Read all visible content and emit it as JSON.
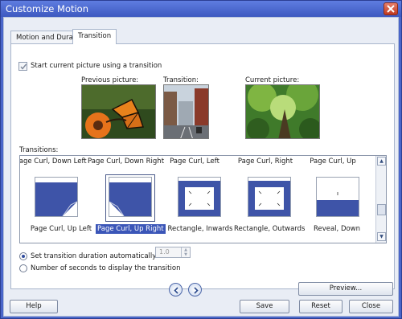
{
  "window": {
    "title": "Customize Motion"
  },
  "tabs": [
    {
      "label": "Motion and Duration"
    },
    {
      "label": "Transition"
    }
  ],
  "transition_panel": {
    "checkbox_label": "Start current picture using a transition",
    "checkbox_checked": true,
    "previews": [
      {
        "label": "Previous picture:"
      },
      {
        "label": "Transition:"
      },
      {
        "label": "Current picture:"
      }
    ],
    "transitions_label": "Transitions:",
    "list_top_row": [
      "Page Curl, Down Left",
      "Page Curl, Down Right",
      "Page Curl, Left",
      "Page Curl, Right",
      "Page Curl, Up"
    ],
    "list_items": [
      {
        "label": "Page Curl, Up Left"
      },
      {
        "label": "Page Curl, Up Right",
        "selected": true
      },
      {
        "label": "Rectangle, Inwards"
      },
      {
        "label": "Rectangle, Outwards"
      },
      {
        "label": "Reveal, Down"
      }
    ],
    "radio_auto": "Set transition duration automatically",
    "radio_seconds": "Number of seconds to display the transition",
    "seconds_value": "1.0",
    "accent_color": "#3b56b8"
  },
  "buttons": {
    "preview": "Preview...",
    "help": "Help",
    "save": "Save",
    "reset": "Reset",
    "close": "Close"
  }
}
